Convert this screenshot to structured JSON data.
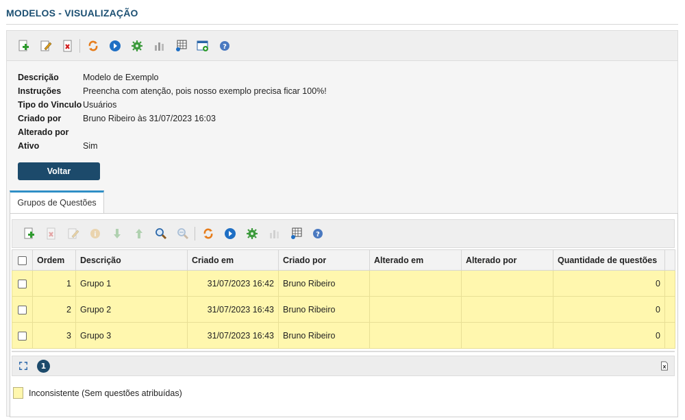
{
  "page": {
    "title": "MODELOS - VISUALIZAÇÃO"
  },
  "main_toolbar": {
    "icons": [
      "add-icon",
      "edit-icon",
      "delete-icon",
      "refresh-icon",
      "play-icon",
      "gear-icon",
      "chart-icon",
      "table-export-icon",
      "window-add-icon",
      "help-icon"
    ]
  },
  "details": {
    "fields": [
      {
        "label": "Descrição",
        "value": "Modelo de Exemplo"
      },
      {
        "label": "Instruções",
        "value": "Preencha com atenção, pois nosso exemplo precisa ficar 100%!"
      },
      {
        "label": "Tipo do Vinculo",
        "value": "Usuários"
      },
      {
        "label": "Criado por",
        "value": "Bruno Ribeiro às 31/07/2023 16:03"
      },
      {
        "label": "Alterado por",
        "value": ""
      },
      {
        "label": "Ativo",
        "value": "Sim"
      }
    ],
    "back_button": "Voltar"
  },
  "tabs": [
    {
      "label": "Grupos de Questões",
      "active": true
    }
  ],
  "grid": {
    "columns": [
      "Ordem",
      "Descrição",
      "Criado em",
      "Criado por",
      "Alterado em",
      "Alterado por",
      "Quantidade de questões"
    ],
    "rows": [
      {
        "ordem": "1",
        "descricao": "Grupo 1",
        "criado_em": "31/07/2023 16:42",
        "criado_por": "Bruno Ribeiro",
        "alterado_em": "",
        "alterado_por": "",
        "quantidade": "0"
      },
      {
        "ordem": "2",
        "descricao": "Grupo 2",
        "criado_em": "31/07/2023 16:43",
        "criado_por": "Bruno Ribeiro",
        "alterado_em": "",
        "alterado_por": "",
        "quantidade": "0"
      },
      {
        "ordem": "3",
        "descricao": "Grupo 3",
        "criado_em": "31/07/2023 16:43",
        "criado_por": "Bruno Ribeiro",
        "alterado_em": "",
        "alterado_por": "",
        "quantidade": "0"
      }
    ],
    "row_color": "#fff7ae"
  },
  "pager": {
    "current_page": "1"
  },
  "legend": {
    "label": "Inconsistente (Sem questões atribuídas)",
    "color": "#fff7ae"
  },
  "colors": {
    "accent": "#1c4a6b",
    "title": "#1b4f72",
    "tab_border": "#2f8fc6"
  }
}
